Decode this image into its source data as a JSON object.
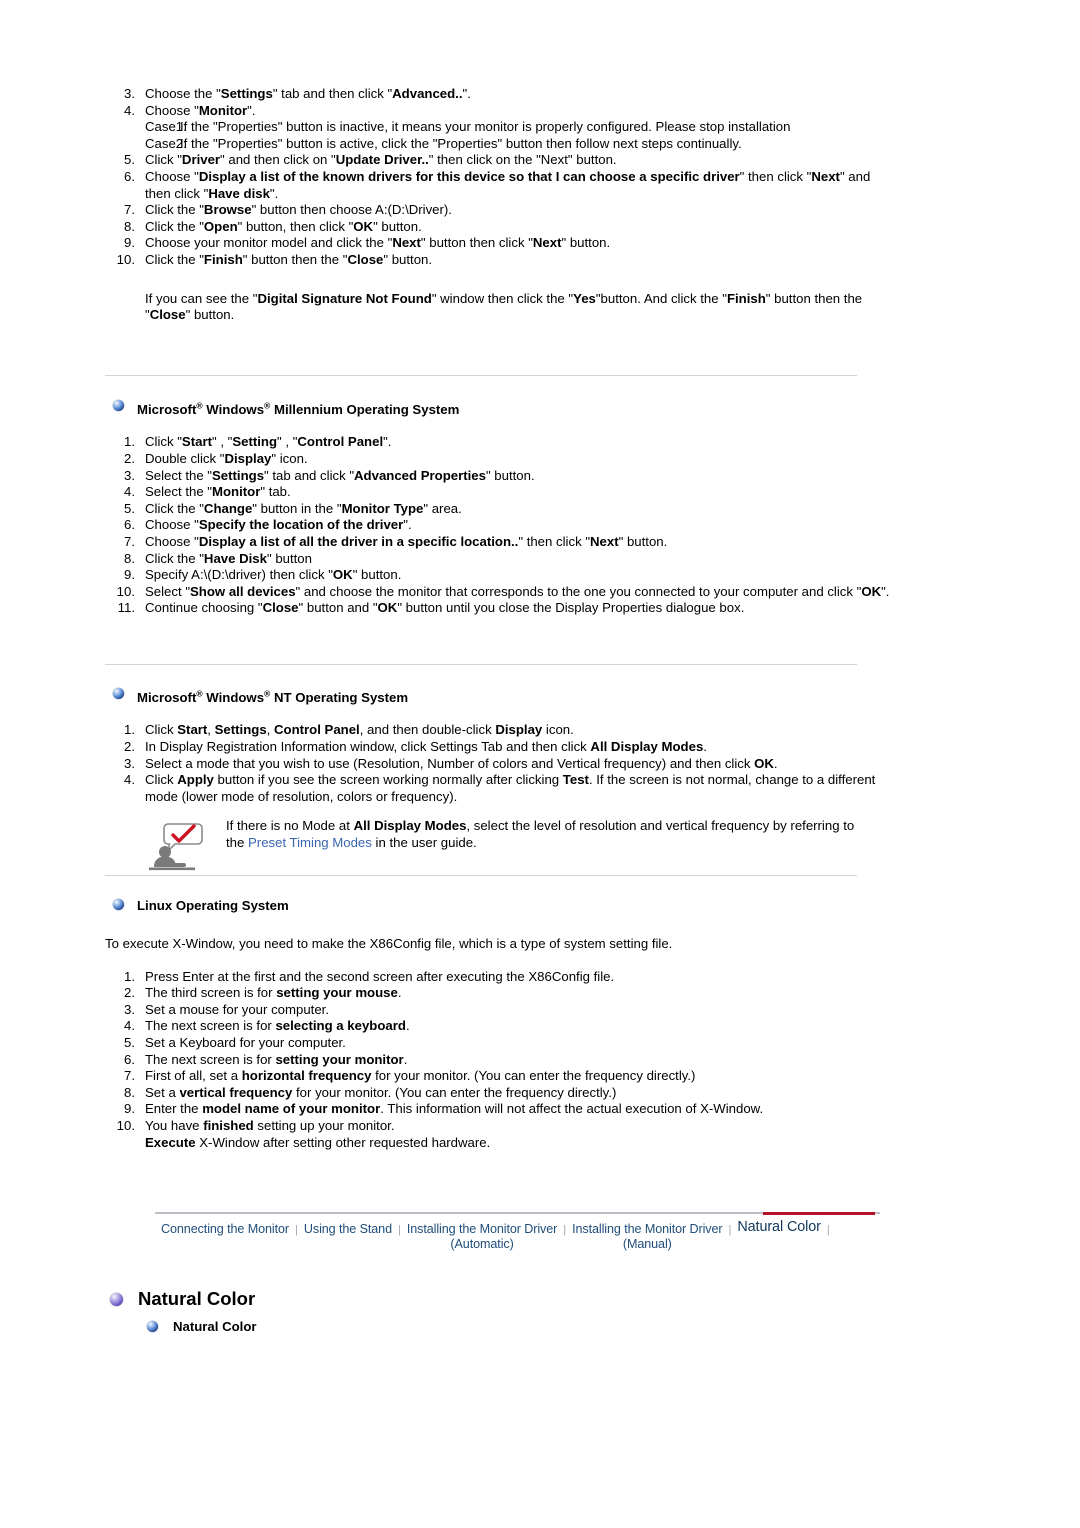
{
  "document": {
    "title": "Natural Color",
    "subtitle": "Natural Color"
  },
  "xp_section": {
    "steps": [
      {
        "num": "3.",
        "html": "Choose the \"<b>Settings</b>\" tab and then click \"<b>Advanced..</b>\"."
      },
      {
        "num": "4.",
        "html": "Choose \"<b>Monitor</b>\"."
      }
    ],
    "cases": [
      {
        "label": "Case1:",
        "text": "If the \"Properties\" button is inactive, it means your monitor is properly configured. Please stop installation"
      },
      {
        "label": "Case2:",
        "text": "If the \"Properties\" button is active, click the \"Properties\" button then follow next steps continually."
      }
    ],
    "steps2": [
      {
        "num": "5.",
        "html": "Click \"<b>Driver</b>\" and then click on \"<b>Update Driver..</b>\" then click on the \"Next\" button."
      },
      {
        "num": "6.",
        "html": "Choose \"<b>Display a list of the known drivers for this device so that I can choose a specific driver</b>\" then click \"<b>Next</b>\" and then click \"<b>Have disk</b>\"."
      },
      {
        "num": "7.",
        "html": "Click the \"<b>Browse</b>\" button then choose A:(D:\\Driver)."
      },
      {
        "num": "8.",
        "html": "Click the \"<b>Open</b>\" button, then click \"<b>OK</b>\" button."
      },
      {
        "num": "9.",
        "html": "Choose your monitor model and click the \"<b>Next</b>\" button then click \"<b>Next</b>\" button."
      },
      {
        "num": "10.",
        "html": "Click the \"<b>Finish</b>\" button then the \"<b>Close</b>\" button."
      }
    ],
    "closing_note": "If you can see the \"<b>Digital Signature Not Found</b>\" window then click the \"<b>Yes</b>\"button. And click the \"<b>Finish</b>\" button then the \"<b>Close</b>\" button."
  },
  "millennium_section": {
    "heading_html": "Microsoft<sup>®</sup> Windows<sup>®</sup> Millennium Operating System",
    "heading_text": "Microsoft® Windows® Millennium Operating System",
    "steps": [
      {
        "num": "1.",
        "html": "Click \"<b>Start</b>\" , \"<b>Setting</b>\" , \"<b>Control Panel</b>\"."
      },
      {
        "num": "2.",
        "html": "Double click \"<b>Display</b>\" icon."
      },
      {
        "num": "3.",
        "html": "Select the \"<b>Settings</b>\" tab and click \"<b>Advanced Properties</b>\" button."
      },
      {
        "num": "4.",
        "html": "Select the \"<b>Monitor</b>\" tab."
      },
      {
        "num": "5.",
        "html": "Click the \"<b>Change</b>\" button in the \"<b>Monitor Type</b>\" area."
      },
      {
        "num": "6.",
        "html": "Choose \"<b>Specify the location of the driver</b>\"."
      },
      {
        "num": "7.",
        "html": "Choose \"<b>Display a list of all the driver in a specific location..</b>\" then click \"<b>Next</b>\" button."
      },
      {
        "num": "8.",
        "html": "Click the \"<b>Have Disk</b>\" button"
      },
      {
        "num": "9.",
        "html": "Specify A:\\(D:\\driver) then click \"<b>OK</b>\" button."
      },
      {
        "num": "10.",
        "html": "Select \"<b>Show all devices</b>\" and choose the monitor that corresponds to the one you connected to your computer and click \"<b>OK</b>\"."
      },
      {
        "num": "11.",
        "html": "Continue choosing \"<b>Close</b>\" button and \"<b>OK</b>\" button until you close the Display Properties dialogue box."
      }
    ]
  },
  "nt_section": {
    "heading_html": "Microsoft<sup>®</sup> Windows<sup>®</sup> NT Operating System",
    "heading_text": "Microsoft® Windows® NT Operating System",
    "steps": [
      {
        "num": "1.",
        "html": "Click <b>Start</b>, <b>Settings</b>, <b>Control Panel</b>, and then double-click <b>Display</b> icon."
      },
      {
        "num": "2.",
        "html": "In Display Registration Information window, click Settings Tab and then click <b>All Display Modes</b>."
      },
      {
        "num": "3.",
        "html": "Select a mode that you wish to use (Resolution, Number of colors and Vertical frequency) and then click <b>OK</b>."
      },
      {
        "num": "4.",
        "html": "Click <b>Apply</b> button if you see the screen working normally after clicking <b>Test</b>. If the screen is not normal, change to a different mode (lower mode of resolution, colors or frequency)."
      }
    ],
    "note": {
      "icon": "person-speech-bubble-check-icon",
      "html": "If there is no Mode at <b>All Display Modes</b>, select the level of resolution and vertical frequency by referring to the <span class=\"link\">Preset Timing Modes</span> in the user guide.",
      "link_text": "Preset Timing Modes"
    }
  },
  "linux_section": {
    "heading_text": "Linux Operating System",
    "intro": "To execute X-Window, you need to make the X86Config file, which is a type of system setting file.",
    "steps": [
      {
        "num": "1.",
        "html": "Press Enter at the first and the second screen after executing the X86Config file."
      },
      {
        "num": "2.",
        "html": "The third screen is for <b>setting your mouse</b>."
      },
      {
        "num": "3.",
        "html": "Set a mouse for your computer."
      },
      {
        "num": "4.",
        "html": "The next screen is for <b>selecting a keyboard</b>."
      },
      {
        "num": "5.",
        "html": "Set a Keyboard for your computer."
      },
      {
        "num": "6.",
        "html": "The next screen is for <b>setting your monitor</b>."
      },
      {
        "num": "7.",
        "html": "First of all, set a <b>horizontal frequency</b> for your monitor. (You can enter the frequency directly.)"
      },
      {
        "num": "8.",
        "html": "Set a <b>vertical frequency</b> for your monitor. (You can enter the frequency directly.)"
      },
      {
        "num": "9.",
        "html": "Enter the <b>model name of your monitor</b>. This information will not affect the actual execution of X-Window."
      },
      {
        "num": "10.",
        "html": "You have <b>finished</b> setting up your monitor.<br><b>Execute</b> X-Window after setting other requested hardware."
      }
    ]
  },
  "bottom_nav": {
    "items": [
      {
        "label": "Connecting  the Monitor",
        "active": false
      },
      {
        "label": "Using the Stand",
        "active": false
      },
      {
        "label": "Installing the Monitor Driver\n(Automatic)",
        "active": false
      },
      {
        "label": "Installing the Monitor Driver\n(Manual)",
        "active": false
      },
      {
        "label": "Natural Color",
        "active": true
      }
    ],
    "separator": "|"
  },
  "colors": {
    "nav_link": "#1f4e79",
    "nav_active_bar": "#b5142b",
    "link": "#3a66b0",
    "rule": "#d3d3d3",
    "bullet_blue": "#2f6bc4",
    "bullet_purple": "#6a58c0"
  }
}
